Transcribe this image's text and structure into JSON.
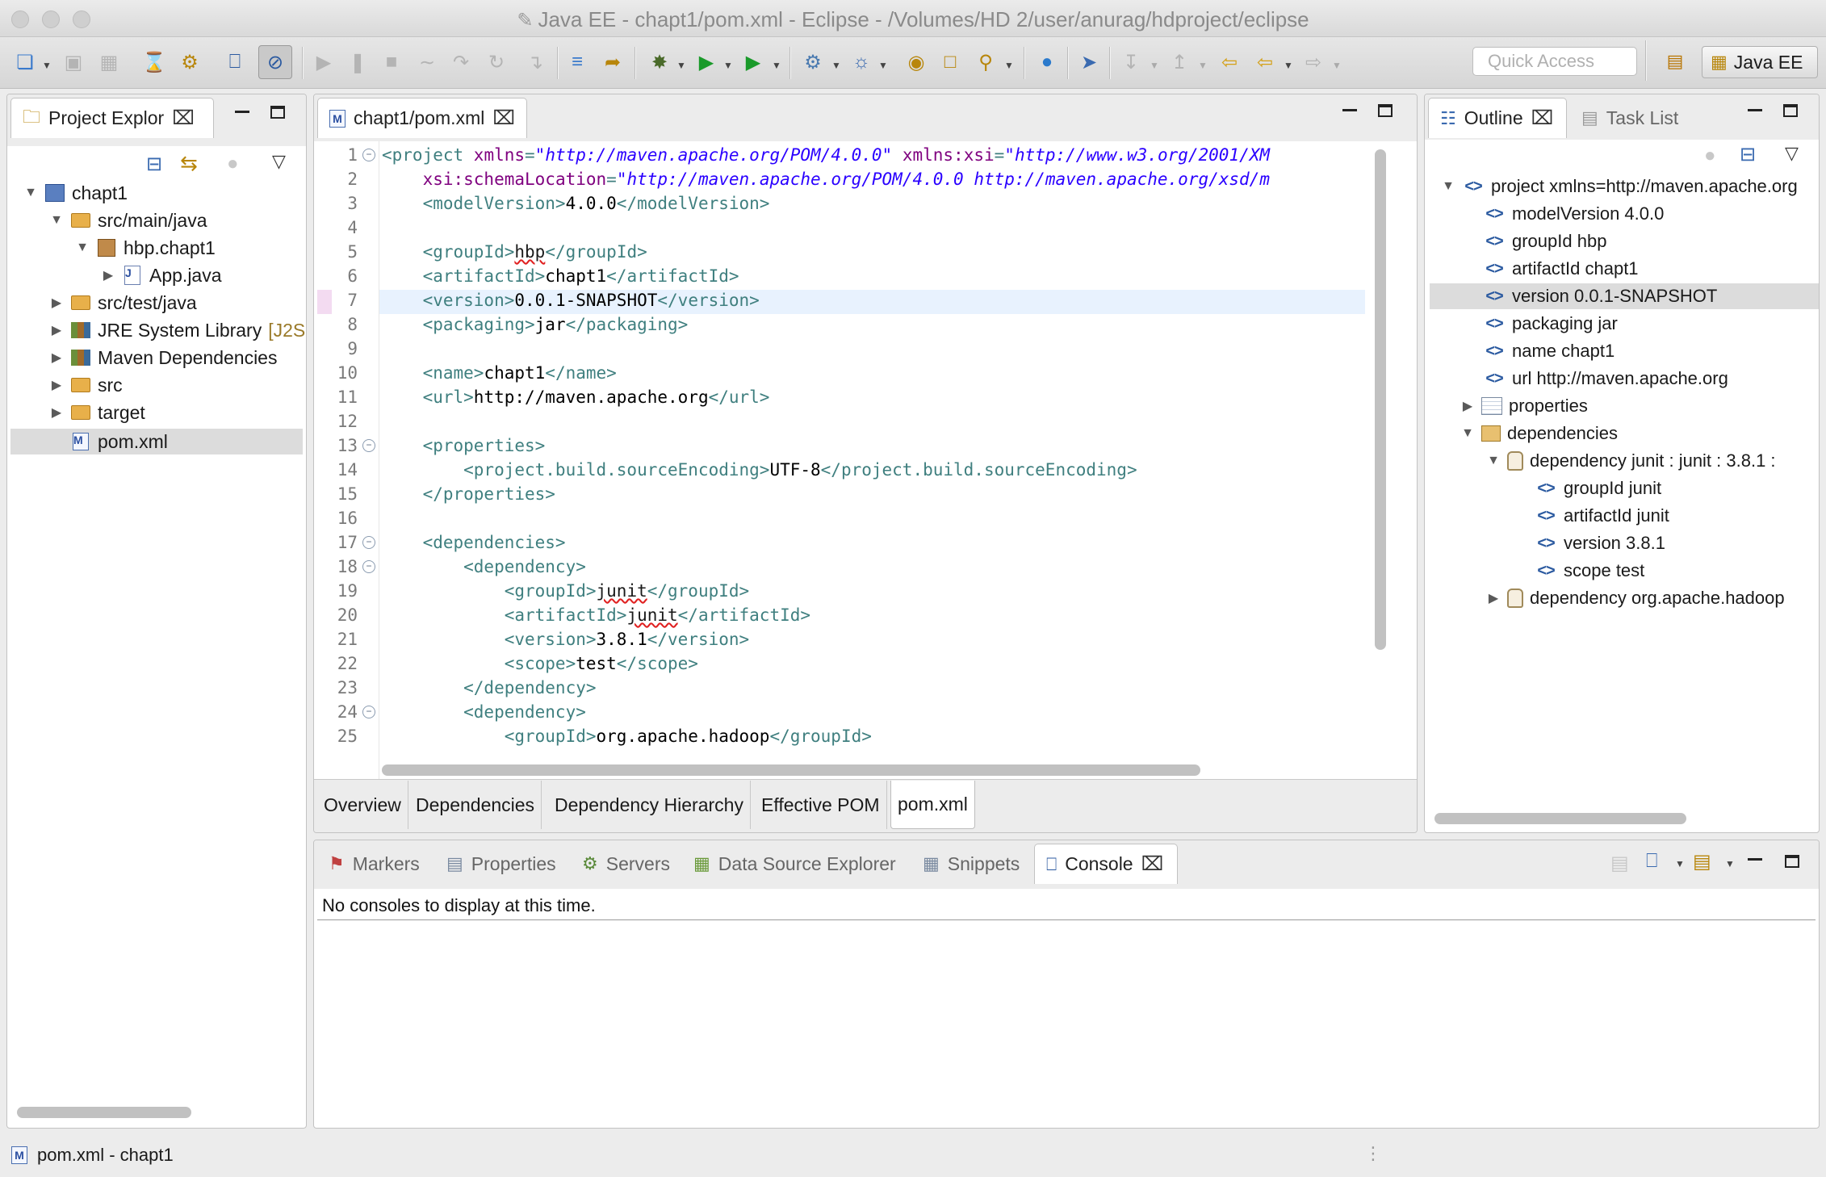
{
  "window": {
    "title": "Java EE - chapt1/pom.xml - Eclipse - /Volumes/HD 2/user/anurag/hdproject/eclipse"
  },
  "toolbar": {
    "quick_access_placeholder": "Quick Access",
    "perspective_label": "Java EE"
  },
  "project_explorer": {
    "tab_label": "Project Explor",
    "tree": [
      {
        "label": "chapt1",
        "icon": "project-icon",
        "expanded": true
      },
      {
        "label": "src/main/java",
        "icon": "source-folder-icon",
        "expanded": true
      },
      {
        "label": "hbp.chapt1",
        "icon": "package-icon",
        "expanded": true
      },
      {
        "label": "App.java",
        "icon": "java-file-icon",
        "expanded": false
      },
      {
        "label": "src/test/java",
        "icon": "source-folder-icon",
        "expanded": false
      },
      {
        "label": "JRE System Library",
        "suffix": "[J2S",
        "icon": "library-icon",
        "expanded": false
      },
      {
        "label": "Maven Dependencies",
        "icon": "library-icon",
        "expanded": false
      },
      {
        "label": "src",
        "icon": "folder-icon",
        "expanded": false
      },
      {
        "label": "target",
        "icon": "folder-icon",
        "expanded": false
      },
      {
        "label": "pom.xml",
        "icon": "maven-file-icon",
        "selected": true
      }
    ]
  },
  "editor": {
    "tab_label": "chapt1/pom.xml",
    "line_numbers": [
      "1",
      "2",
      "3",
      "4",
      "5",
      "6",
      "7",
      "8",
      "9",
      "10",
      "11",
      "12",
      "13",
      "14",
      "15",
      "16",
      "17",
      "18",
      "19",
      "20",
      "21",
      "22",
      "23",
      "24",
      "25"
    ],
    "lines": [
      [
        [
          "tag",
          "<project "
        ],
        [
          "attr",
          "xmlns"
        ],
        [
          "tag",
          "="
        ],
        [
          "val",
          "\"http://maven.apache.org/POM/4.0.0\""
        ],
        [
          "tag",
          " "
        ],
        [
          "attr",
          "xmlns:xsi"
        ],
        [
          "tag",
          "="
        ],
        [
          "val",
          "\"http://www.w3.org/2001/XM"
        ]
      ],
      [
        [
          "tag",
          "    "
        ],
        [
          "attr",
          "xsi:schemaLocation"
        ],
        [
          "tag",
          "="
        ],
        [
          "val",
          "\"http://maven.apache.org/POM/4.0.0 http://maven.apache.org/xsd/m"
        ]
      ],
      [
        [
          "tag",
          "    <modelVersion>"
        ],
        [
          "txt",
          "4.0.0"
        ],
        [
          "tag",
          "</modelVersion>"
        ]
      ],
      [],
      [
        [
          "tag",
          "    <groupId>"
        ],
        [
          "squig",
          "hbp"
        ],
        [
          "tag",
          "</groupId>"
        ]
      ],
      [
        [
          "tag",
          "    <artifactId>"
        ],
        [
          "txt",
          "chapt1"
        ],
        [
          "tag",
          "</artifactId>"
        ]
      ],
      [
        [
          "tag",
          "    <version>"
        ],
        [
          "txt",
          "0.0.1-SNAPSHOT"
        ],
        [
          "tag",
          "</version>"
        ]
      ],
      [
        [
          "tag",
          "    <packaging>"
        ],
        [
          "txt",
          "jar"
        ],
        [
          "tag",
          "</packaging>"
        ]
      ],
      [],
      [
        [
          "tag",
          "    <name>"
        ],
        [
          "txt",
          "chapt1"
        ],
        [
          "tag",
          "</name>"
        ]
      ],
      [
        [
          "tag",
          "    <url>"
        ],
        [
          "txt",
          "http://maven.apache.org"
        ],
        [
          "tag",
          "</url>"
        ]
      ],
      [],
      [
        [
          "tag",
          "    <properties>"
        ]
      ],
      [
        [
          "tag",
          "        <project.build.sourceEncoding>"
        ],
        [
          "txt",
          "UTF-8"
        ],
        [
          "tag",
          "</project.build.sourceEncoding>"
        ]
      ],
      [
        [
          "tag",
          "    </properties>"
        ]
      ],
      [],
      [
        [
          "tag",
          "    <dependencies>"
        ]
      ],
      [
        [
          "tag",
          "        <dependency>"
        ]
      ],
      [
        [
          "tag",
          "            <groupId>"
        ],
        [
          "squig",
          "junit"
        ],
        [
          "tag",
          "</groupId>"
        ]
      ],
      [
        [
          "tag",
          "            <artifactId>"
        ],
        [
          "squig",
          "junit"
        ],
        [
          "tag",
          "</artifactId>"
        ]
      ],
      [
        [
          "tag",
          "            <version>"
        ],
        [
          "txt",
          "3.8.1"
        ],
        [
          "tag",
          "</version>"
        ]
      ],
      [
        [
          "tag",
          "            <scope>"
        ],
        [
          "txt",
          "test"
        ],
        [
          "tag",
          "</scope>"
        ]
      ],
      [
        [
          "tag",
          "        </dependency>"
        ]
      ],
      [
        [
          "tag",
          "        <dependency>"
        ]
      ],
      [
        [
          "tag",
          "            <groupId>"
        ],
        [
          "txt",
          "org.apache.hadoop"
        ],
        [
          "tag",
          "</groupId>"
        ]
      ]
    ],
    "bottom_tabs": [
      "Overview",
      "Dependencies",
      "Dependency Hierarchy",
      "Effective POM",
      "pom.xml"
    ]
  },
  "outline": {
    "tab_label": "Outline",
    "task_list_label": "Task List",
    "items": [
      {
        "label": "project xmlns=http://maven.apache.org"
      },
      {
        "label": "modelVersion  4.0.0"
      },
      {
        "label": "groupId  hbp"
      },
      {
        "label": "artifactId  chapt1"
      },
      {
        "label": "version  0.0.1-SNAPSHOT",
        "selected": true
      },
      {
        "label": "packaging  jar"
      },
      {
        "label": "name  chapt1"
      },
      {
        "label": "url  http://maven.apache.org"
      },
      {
        "label": "properties"
      },
      {
        "label": "dependencies"
      },
      {
        "label": "dependency  junit : junit : 3.8.1 :"
      },
      {
        "label": "groupId  junit"
      },
      {
        "label": "artifactId  junit"
      },
      {
        "label": "version  3.8.1"
      },
      {
        "label": "scope  test"
      },
      {
        "label": "dependency  org.apache.hadoop"
      }
    ]
  },
  "bottom_panel": {
    "tabs": [
      "Markers",
      "Properties",
      "Servers",
      "Data Source Explorer",
      "Snippets",
      "Console"
    ],
    "console_message": "No consoles to display at this time."
  },
  "status_bar": {
    "text": "pom.xml - chapt1"
  },
  "colors": {
    "xml_tag": "#3f7f7f",
    "xml_attr": "#7f007f",
    "xml_value": "#2a00ff",
    "current_line": "#e8f2fe",
    "selection": "#dcdcdc"
  }
}
